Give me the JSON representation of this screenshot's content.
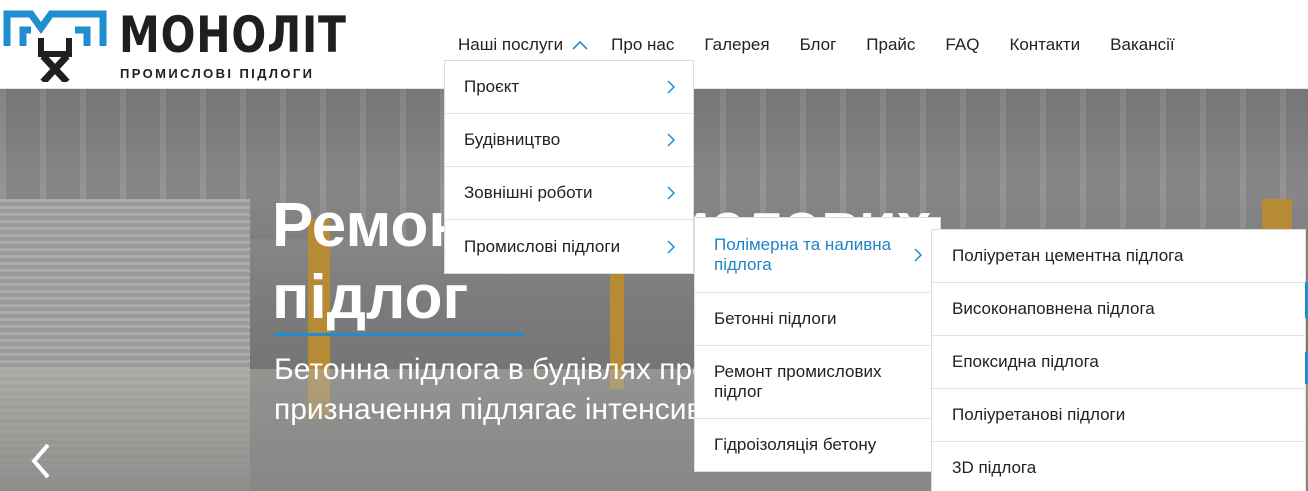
{
  "brand": {
    "name": "МОНОЛІТ",
    "tagline": "ПРОМИСЛОВІ ПІДЛОГИ",
    "colors": {
      "logo_blue": "#1e8ed0",
      "logo_dark": "#1f1f1f"
    }
  },
  "nav": {
    "items": [
      {
        "label": "Наші послуги",
        "icon": "chevron-up-icon"
      },
      {
        "label": "Про нас"
      },
      {
        "label": "Галерея"
      },
      {
        "label": "Блог"
      },
      {
        "label": "Прайс"
      },
      {
        "label": "FAQ"
      },
      {
        "label": "Контакти"
      },
      {
        "label": "Вакансії"
      }
    ]
  },
  "menu_level1": {
    "items": [
      {
        "label": "Проєкт"
      },
      {
        "label": "Будівництво"
      },
      {
        "label": "Зовнішні роботи"
      },
      {
        "label": "Промислові підлоги"
      }
    ]
  },
  "menu_level2": {
    "items": [
      {
        "label": "Полімерна та наливна підлога",
        "active": true
      },
      {
        "label": "Бетонні підлоги"
      },
      {
        "label": "Ремонт промислових підлог"
      },
      {
        "label": "Гідроізоляція бетону"
      }
    ]
  },
  "menu_level3": {
    "items": [
      {
        "label": "Поліуретан цементна підлога"
      },
      {
        "label": "Високонаповнена підлога"
      },
      {
        "label": "Епоксидна підлога"
      },
      {
        "label": "Поліуретанові підлоги"
      },
      {
        "label": "3D підлога"
      }
    ]
  },
  "hero": {
    "title": "Ремонт промислових підлог",
    "subtitle": "Бетонна підлога в будівлях промислового та комерційного призначення підлягає інтенсивному",
    "prev_icon": "chevron-left-icon",
    "accent_color": "#1e8ed0"
  }
}
